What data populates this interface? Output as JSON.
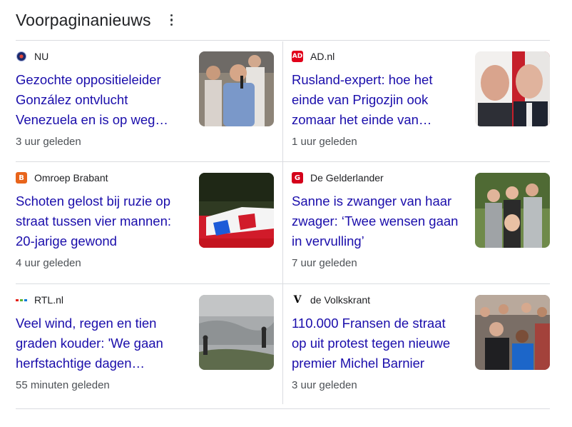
{
  "header": {
    "title": "Voorpaginanieuws"
  },
  "articles": [
    {
      "source": "NU",
      "headline": "Gezochte oppositieleider González ontvlucht Venezuela en is op weg…",
      "time": "3 uur geleden",
      "logo_icon": "nu-logo-icon",
      "logo_color": "#1b2a6b"
    },
    {
      "source": "AD.nl",
      "headline": "Rusland-expert: hoe het einde van Prigozjin ook zomaar het einde van…",
      "time": "1 uur geleden",
      "logo_icon": "ad-logo-icon",
      "logo_color": "#e1001a",
      "logo_text": "AD"
    },
    {
      "source": "Omroep Brabant",
      "headline": "Schoten gelost bij ruzie op straat tussen vier mannen: 20-jarige gewond",
      "time": "4 uur geleden",
      "logo_icon": "omroep-brabant-logo-icon",
      "logo_color": "#e8641b",
      "logo_text": "B"
    },
    {
      "source": "De Gelderlander",
      "headline": "Sanne is zwanger van haar zwager: ‘Twee wensen gaan in vervulling’",
      "time": "7 uur geleden",
      "logo_icon": "de-gelderlander-logo-icon",
      "logo_color": "#d4001a",
      "logo_text": "G"
    },
    {
      "source": "RTL.nl",
      "headline": "Veel wind, regen en tien graden kouder: 'We gaan herfstachtige dagen…",
      "time": "55 minuten geleden",
      "logo_icon": "rtl-logo-icon",
      "logo_color": "#0a7ad9"
    },
    {
      "source": "de Volkskrant",
      "headline": "110.000 Fransen de straat op uit protest tegen nieuwe premier Michel Barnier",
      "time": "3 uur geleden",
      "logo_icon": "volkskrant-logo-icon",
      "logo_color": "#000000",
      "logo_text": "V"
    }
  ]
}
